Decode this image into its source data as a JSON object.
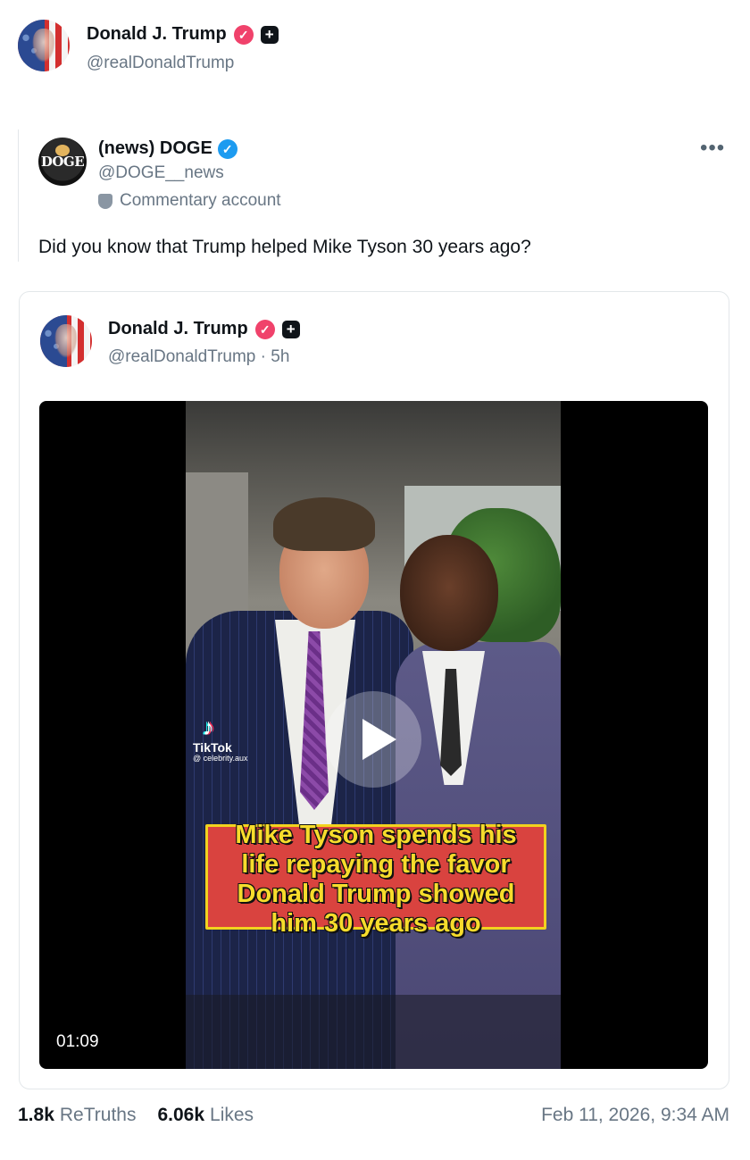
{
  "post": {
    "author_name": "Donald J. Trump",
    "author_handle": "@realDonaldTrump",
    "verified_icon": "verified-check-icon",
    "plus_icon": "plus-square-icon"
  },
  "quote": {
    "author_name": "(news) DOGE",
    "author_handle": "@DOGE__news",
    "avatar_text": "DOGE",
    "commentary_label": "Commentary account",
    "more_icon": "•••",
    "text": "Did you know that Trump helped Mike Tyson 30 years ago?"
  },
  "embed": {
    "author_name": "Donald J. Trump",
    "author_handle": "@realDonaldTrump · 5h",
    "video": {
      "tiktok_glyph": "♪",
      "tiktok_label": "TikTok",
      "tiktok_user": "@ celebrity.aux",
      "caption_lines": [
        "Mike Tyson spends his",
        "life repaying the favor",
        "Donald Trump showed",
        "him 30 years ago"
      ],
      "duration": "01:09"
    }
  },
  "footer": {
    "retruths_count": "1.8k",
    "retruths_label": "ReTruths",
    "likes_count": "6.06k",
    "likes_label": "Likes",
    "timestamp": "Feb 11, 2026, 9:34 AM"
  },
  "colors": {
    "verified_pink": "#f0426b",
    "verified_blue": "#1d9bf0",
    "caption_red": "#d9433f",
    "caption_yellow": "#f7dc2c",
    "muted_text": "#687684"
  }
}
